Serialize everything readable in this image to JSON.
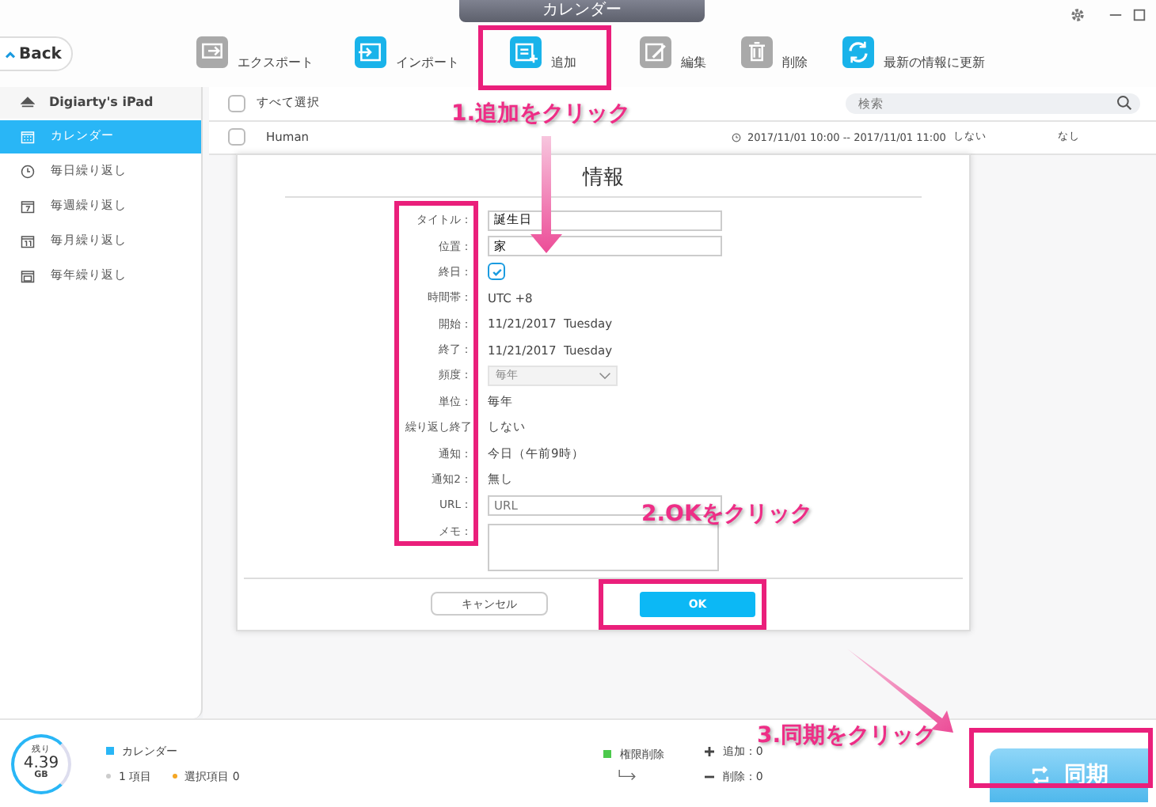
{
  "window": {
    "title": "カレンダー"
  },
  "toolbar": {
    "back": "Back",
    "items": [
      {
        "label": "エクスポート",
        "disabled": true
      },
      {
        "label": "インポート",
        "disabled": false
      },
      {
        "label": "追加",
        "disabled": false
      },
      {
        "label": "編集",
        "disabled": true
      },
      {
        "label": "削除",
        "disabled": true
      },
      {
        "label": "最新の情報に更新",
        "disabled": false
      }
    ]
  },
  "sidebar": {
    "device": "Digiarty's iPad",
    "items": [
      {
        "label": "カレンダー",
        "selected": true
      },
      {
        "label": "毎日繰り返し",
        "selected": false
      },
      {
        "label": "毎週繰り返し",
        "selected": false
      },
      {
        "label": "毎月繰り返し",
        "selected": false
      },
      {
        "label": "毎年繰り返し",
        "selected": false
      }
    ]
  },
  "list": {
    "select_all": "すべて選択",
    "all_checked": false,
    "search": {
      "placeholder": "検索"
    },
    "rows": [
      {
        "title": "Human",
        "checked": false,
        "time": "2017/11/01 10:00 -- 2017/11/01 11:00",
        "repeat": "しない",
        "alarm": "なし"
      }
    ]
  },
  "dialog": {
    "title": "情報",
    "fields": [
      {
        "kind": "input",
        "label": "タイトル：",
        "value": "誕生日"
      },
      {
        "kind": "input",
        "label": "位置：",
        "value": "家"
      },
      {
        "kind": "checkbox",
        "label": "終日：",
        "checked": true
      },
      {
        "kind": "text",
        "label": "時間帯：",
        "value": "UTC +8"
      },
      {
        "kind": "text",
        "label": "開始：",
        "value": "11/21/2017  Tuesday"
      },
      {
        "kind": "text",
        "label": "終了：",
        "value": "11/21/2017  Tuesday"
      },
      {
        "kind": "select",
        "label": "頻度：",
        "value": "毎年"
      },
      {
        "kind": "text",
        "label": "単位：",
        "value": "毎年"
      },
      {
        "kind": "text",
        "label": "繰り返し終了",
        "value": "しない"
      },
      {
        "kind": "text",
        "label": "通知：",
        "value": "今日（午前9時）"
      },
      {
        "kind": "text",
        "label": "通知2：",
        "value": "無し"
      },
      {
        "kind": "input",
        "label": "URL：",
        "placeholder": "URL"
      },
      {
        "kind": "textarea",
        "label": "メモ："
      }
    ],
    "cancel": "キャンセル",
    "ok": "OK"
  },
  "footer": {
    "storage": {
      "label": "残り",
      "value": "4.39",
      "unit": "GB"
    },
    "calendar": {
      "label": "カレンダー",
      "color": "#29b6f6"
    },
    "count": "1 項目",
    "selected": {
      "label": "選択項目 0",
      "color": "#f5a623"
    },
    "permission": {
      "label": "権限削除",
      "color": "#4cc94c"
    },
    "added": "追加：0",
    "deleted": "削除：0",
    "sync": "同期"
  },
  "annotations": [
    {
      "text": "1.追加をクリック"
    },
    {
      "text": "2.OKをクリック"
    },
    {
      "text": "3.同期をクリック"
    }
  ]
}
